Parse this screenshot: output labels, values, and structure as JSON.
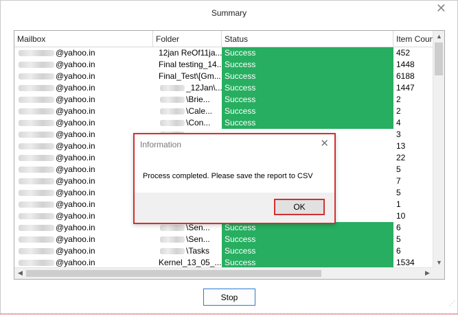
{
  "window": {
    "title": "Summary"
  },
  "table": {
    "columns": [
      "Mailbox",
      "Folder",
      "Status",
      "Item Count"
    ],
    "rows": [
      {
        "mailbox": "@yahoo.in",
        "folder": "12jan ReOf11ja...",
        "status": "Success",
        "count": "452",
        "blur_folder": false
      },
      {
        "mailbox": "@yahoo.in",
        "folder": "Final testing_14...",
        "status": "Success",
        "count": "1448",
        "blur_folder": false
      },
      {
        "mailbox": "@yahoo.in",
        "folder": "Final_Test\\[Gm...",
        "status": "Success",
        "count": "6188",
        "blur_folder": false
      },
      {
        "mailbox": "@yahoo.in",
        "folder": "_12Jan\\...",
        "status": "Success",
        "count": "1447",
        "blur_folder": true
      },
      {
        "mailbox": "@yahoo.in",
        "folder": "\\Brie...",
        "status": "Success",
        "count": "2",
        "blur_folder": true
      },
      {
        "mailbox": "@yahoo.in",
        "folder": "\\Cale...",
        "status": "Success",
        "count": "2",
        "blur_folder": true
      },
      {
        "mailbox": "@yahoo.in",
        "folder": "\\Con...",
        "status": "Success",
        "count": "4",
        "blur_folder": true
      },
      {
        "mailbox": "@yahoo.in",
        "folder": "",
        "status": "",
        "count": "3",
        "blur_folder": true
      },
      {
        "mailbox": "@yahoo.in",
        "folder": "",
        "status": "",
        "count": "13",
        "blur_folder": false
      },
      {
        "mailbox": "@yahoo.in",
        "folder": "",
        "status": "",
        "count": "22",
        "blur_folder": false
      },
      {
        "mailbox": "@yahoo.in",
        "folder": "",
        "status": "",
        "count": "5",
        "blur_folder": false
      },
      {
        "mailbox": "@yahoo.in",
        "folder": "",
        "status": "",
        "count": "7",
        "blur_folder": false
      },
      {
        "mailbox": "@yahoo.in",
        "folder": "",
        "status": "",
        "count": "5",
        "blur_folder": false
      },
      {
        "mailbox": "@yahoo.in",
        "folder": "",
        "status": "",
        "count": "1",
        "blur_folder": false
      },
      {
        "mailbox": "@yahoo.in",
        "folder": "",
        "status": "",
        "count": "10",
        "blur_folder": false
      },
      {
        "mailbox": "@yahoo.in",
        "folder": "\\Sen...",
        "status": "Success",
        "count": "6",
        "blur_folder": true
      },
      {
        "mailbox": "@yahoo.in",
        "folder": "\\Sen...",
        "status": "Success",
        "count": "5",
        "blur_folder": true
      },
      {
        "mailbox": "@yahoo.in",
        "folder": "\\Tasks",
        "status": "Success",
        "count": "6",
        "blur_folder": true
      },
      {
        "mailbox": "@yahoo.in",
        "folder": "Kernel_13_05_...",
        "status": "Success",
        "count": "1534",
        "blur_folder": false
      }
    ]
  },
  "buttons": {
    "stop": "Stop"
  },
  "dialog": {
    "title": "Information",
    "message": "Process completed. Please save the report to CSV",
    "ok": "OK"
  },
  "icons": {
    "close": "close-icon",
    "scroll_up": "arrow-up-icon",
    "scroll_down": "arrow-down-icon",
    "scroll_left": "arrow-left-icon",
    "scroll_right": "arrow-right-icon"
  },
  "colors": {
    "success": "#27ae60",
    "highlight": "#d32f2f",
    "stop_border": "#2b79d3"
  }
}
